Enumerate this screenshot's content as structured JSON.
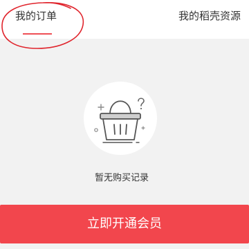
{
  "tabs": [
    {
      "label": "我的订单"
    },
    {
      "label": "我的稻壳资源"
    }
  ],
  "empty_state": {
    "icon": "empty-basket-icon",
    "message": "暂无购买记录"
  },
  "cta": {
    "label": "立即开通会员"
  },
  "colors": {
    "accent": "#f2464d",
    "annotation": "#e0242c",
    "background": "#f2f2f2"
  }
}
